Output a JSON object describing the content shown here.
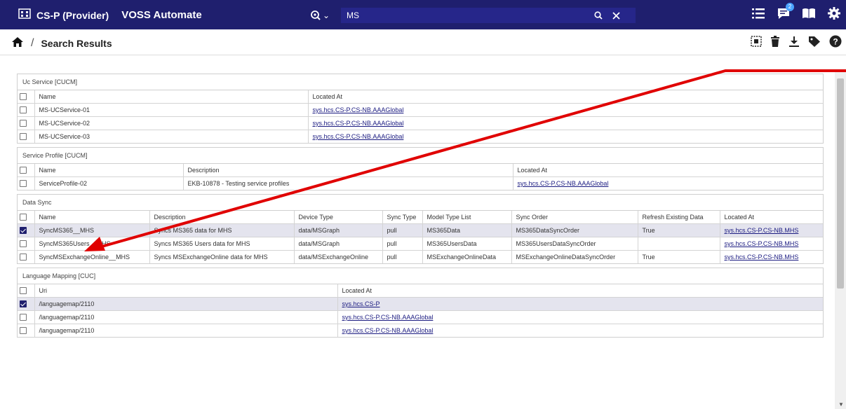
{
  "header": {
    "tenant": "CS-P (Provider)",
    "app": "VOSS Automate",
    "search_value": "MS",
    "notification_count": "2"
  },
  "breadcrumb": {
    "title": "Search Results",
    "separator": "/"
  },
  "sections": [
    {
      "title": "Uc Service [CUCM]",
      "columns": [
        "Name",
        "Located At"
      ],
      "widths": [
        390,
        0
      ],
      "rows": [
        {
          "checked": false,
          "cells": [
            "MS-UCService-01",
            "sys.hcs.CS-P.CS-NB.AAAGlobal"
          ]
        },
        {
          "checked": false,
          "cells": [
            "MS-UCService-02",
            "sys.hcs.CS-P.CS-NB.AAAGlobal"
          ]
        },
        {
          "checked": false,
          "cells": [
            "MS-UCService-03",
            "sys.hcs.CS-P.CS-NB.AAAGlobal"
          ]
        }
      ],
      "link_col": 1
    },
    {
      "title": "Service Profile [CUCM]",
      "columns": [
        "Name",
        "Description",
        "Located At"
      ],
      "widths": [
        212,
        470,
        0
      ],
      "rows": [
        {
          "checked": false,
          "cells": [
            "ServiceProfile-02",
            "EKB-10878 - Testing service profiles",
            "sys.hcs.CS-P.CS-NB.AAAGlobal"
          ]
        }
      ],
      "link_col": 2
    },
    {
      "title": "Data Sync",
      "columns": [
        "Name",
        "Description",
        "Device Type",
        "Sync Type",
        "Model Type List",
        "Sync Order",
        "Refresh Existing Data",
        "Located At"
      ],
      "widths": [
        164,
        206,
        126,
        57,
        127,
        180,
        117,
        0
      ],
      "rows": [
        {
          "checked": true,
          "cells": [
            "SyncMS365__MHS",
            "Syncs MS365 data for MHS",
            "data/MSGraph",
            "pull",
            "MS365Data",
            "MS365DataSyncOrder",
            "True",
            "sys.hcs.CS-P.CS-NB.MHS"
          ]
        },
        {
          "checked": false,
          "cells": [
            "SyncMS365Users__MHS",
            "Syncs MS365 Users data for MHS",
            "data/MSGraph",
            "pull",
            "MS365UsersData",
            "MS365UsersDataSyncOrder",
            "",
            "sys.hcs.CS-P.CS-NB.MHS"
          ]
        },
        {
          "checked": false,
          "cells": [
            "SyncMSExchangeOnline__MHS",
            "Syncs MSExchangeOnline data for MHS",
            "data/MSExchangeOnline",
            "pull",
            "MSExchangeOnlineData",
            "MSExchangeOnlineDataSyncOrder",
            "True",
            "sys.hcs.CS-P.CS-NB.MHS"
          ]
        }
      ],
      "link_col": 7
    },
    {
      "title": "Language Mapping [CUC]",
      "columns": [
        "Uri",
        "Located At"
      ],
      "widths": [
        432,
        0
      ],
      "rows": [
        {
          "checked": true,
          "cells": [
            "/languagemap/2110",
            "sys.hcs.CS-P"
          ]
        },
        {
          "checked": false,
          "cells": [
            "/languagemap/2110",
            "sys.hcs.CS-P.CS-NB.AAAGlobal"
          ]
        },
        {
          "checked": false,
          "cells": [
            "/languagemap/2110",
            "sys.hcs.CS-P.CS-NB.AAAGlobal"
          ]
        }
      ],
      "link_col": 1
    }
  ],
  "colors": {
    "header_bg": "#1f1f6e",
    "annotation": "#e00000",
    "selected_row": "#e4e4ee"
  }
}
